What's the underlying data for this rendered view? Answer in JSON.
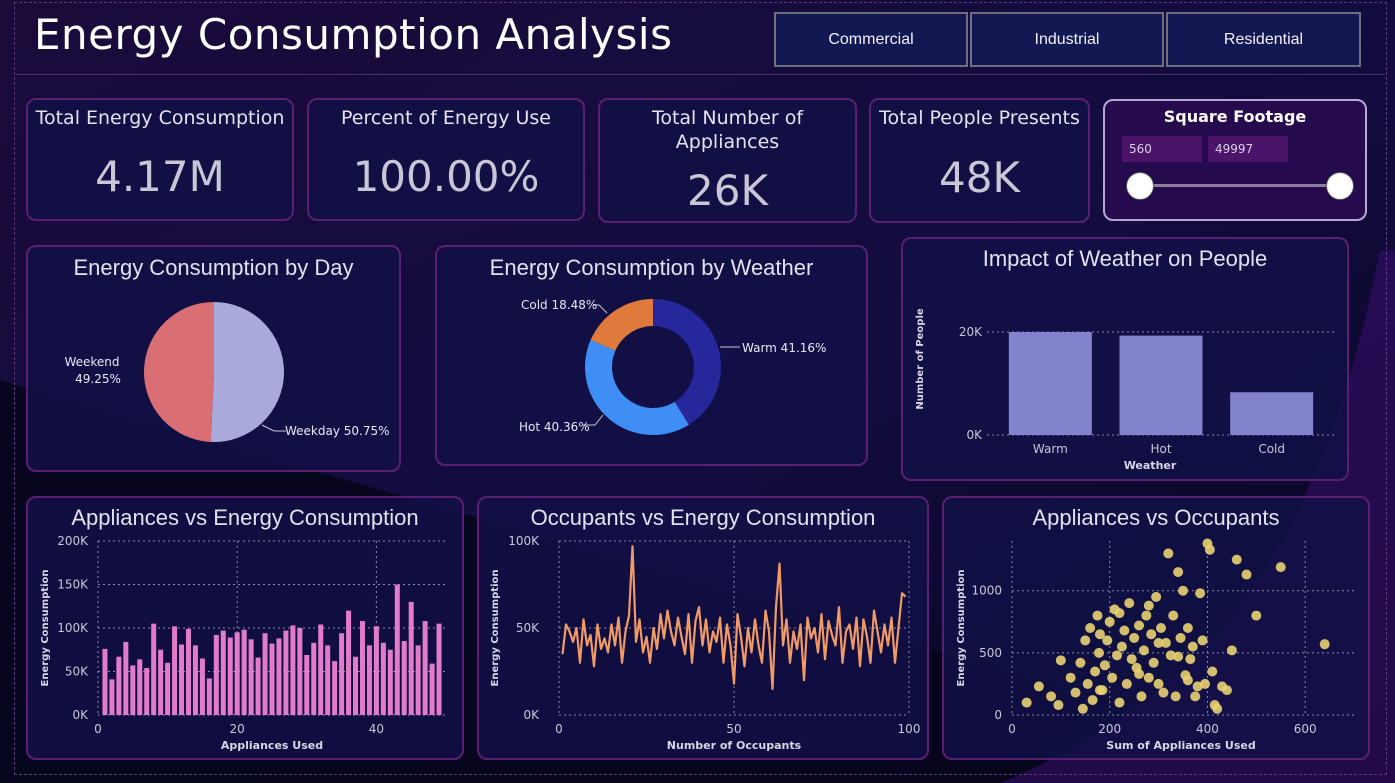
{
  "header": {
    "title": "Energy Consumption Analysis"
  },
  "segments": [
    "Commercial",
    "Industrial",
    "Residential"
  ],
  "kpis": [
    {
      "label": "Total Energy Consumption",
      "value": "4.17M"
    },
    {
      "label": "Percent of Energy Use",
      "value": "100.00%"
    },
    {
      "label": "Total Number of Appliances",
      "value": "26K"
    },
    {
      "label": "Total People Presents",
      "value": "48K"
    }
  ],
  "slider": {
    "label": "Square Footage",
    "min": "560",
    "max": "49997"
  },
  "chart_data": [
    {
      "type": "pie",
      "title": "Energy Consumption by Day",
      "categories": [
        "Weekday",
        "Weekend"
      ],
      "values": [
        50.75,
        49.25
      ],
      "labels": [
        "Weekday 50.75%",
        "Weekend",
        "49.25%"
      ],
      "colors": [
        "#aaa9db",
        "#d96f75"
      ]
    },
    {
      "type": "pie",
      "title": "Energy Consumption by Weather",
      "categories": [
        "Warm",
        "Hot",
        "Cold"
      ],
      "values": [
        41.16,
        40.36,
        18.48
      ],
      "labels": [
        "Warm 41.16%",
        "Hot 40.36%",
        "Cold 18.48%"
      ],
      "colors": [
        "#25279a",
        "#3f8ef5",
        "#e07a3c"
      ]
    },
    {
      "type": "bar",
      "title": "Impact of Weather on People",
      "categories": [
        "Warm",
        "Hot",
        "Cold"
      ],
      "values": [
        20000,
        19300,
        8300
      ],
      "xlabel": "Weather",
      "ylabel": "Number of People",
      "yticks": [
        "0K",
        "20K"
      ],
      "ylim": [
        0,
        20000
      ],
      "color": "#8283cc"
    },
    {
      "type": "bar",
      "title": "Appliances vs Energy Consumption",
      "xlabel": "Appliances Used",
      "ylabel": "Energy Consumption",
      "x": [
        1,
        2,
        3,
        4,
        5,
        6,
        7,
        8,
        9,
        10,
        11,
        12,
        13,
        14,
        15,
        16,
        17,
        18,
        19,
        20,
        21,
        22,
        23,
        24,
        25,
        26,
        27,
        28,
        29,
        30,
        31,
        32,
        33,
        34,
        35,
        36,
        37,
        38,
        39,
        40,
        41,
        42,
        43,
        44,
        45,
        46,
        47,
        48,
        49
      ],
      "values": [
        76000,
        41000,
        67000,
        84000,
        57000,
        64000,
        54000,
        105000,
        75000,
        60000,
        102000,
        81000,
        99000,
        80000,
        65000,
        42000,
        92000,
        97000,
        89000,
        95000,
        98000,
        87000,
        66000,
        94000,
        82000,
        88000,
        97000,
        103000,
        100000,
        69000,
        83000,
        104000,
        80000,
        62000,
        94000,
        120000,
        67000,
        108000,
        80000,
        102000,
        83000,
        75000,
        150000,
        85000,
        130000,
        80000,
        108000,
        59000,
        105000
      ],
      "ylim": [
        0,
        200000
      ],
      "yticks": [
        "0K",
        "50K",
        "100K",
        "150K",
        "200K"
      ],
      "xticks": [
        "0",
        "20",
        "40"
      ],
      "color": "#e27bc9"
    },
    {
      "type": "line",
      "title": "Occupants vs Energy Consumption",
      "xlabel": "Number of Occupants",
      "ylabel": "Energy Consumption",
      "values": [
        35000,
        52000,
        48000,
        42000,
        50000,
        30000,
        55000,
        40000,
        46000,
        28000,
        52000,
        38000,
        44000,
        36000,
        52000,
        40000,
        56000,
        30000,
        48000,
        57000,
        97000,
        42000,
        55000,
        36000,
        45000,
        30000,
        50000,
        38000,
        58000,
        44000,
        60000,
        48000,
        40000,
        56000,
        45000,
        35000,
        58000,
        30000,
        54000,
        62000,
        40000,
        55000,
        36000,
        48000,
        42000,
        56000,
        30000,
        52000,
        40000,
        18000,
        58000,
        45000,
        28000,
        50000,
        36000,
        55000,
        40000,
        30000,
        60000,
        48000,
        15000,
        62000,
        87000,
        40000,
        55000,
        30000,
        48000,
        38000,
        52000,
        20000,
        56000,
        44000,
        50000,
        36000,
        58000,
        32000,
        54000,
        46000,
        40000,
        62000,
        30000,
        48000,
        52000,
        38000,
        56000,
        28000,
        55000,
        45000,
        30000,
        60000,
        48000,
        36000,
        52000,
        40000,
        56000,
        30000,
        50000,
        70000,
        68000
      ],
      "xlim": [
        0,
        100
      ],
      "ylim": [
        0,
        100000
      ],
      "yticks": [
        "0K",
        "50K",
        "100K"
      ],
      "xticks": [
        "0",
        "50",
        "100"
      ],
      "color": "#f09a66"
    },
    {
      "type": "scatter",
      "title": "Appliances vs Occupants",
      "xlabel": "Sum of Appliances Used",
      "ylabel": "Energy Consumption",
      "xlim": [
        0,
        700
      ],
      "ylim": [
        0,
        1400
      ],
      "xticks": [
        "0",
        "200",
        "400",
        "600"
      ],
      "yticks": [
        "0",
        "500",
        "1000"
      ],
      "color": "#e8d271",
      "points": [
        [
          30,
          100
        ],
        [
          55,
          230
        ],
        [
          80,
          150
        ],
        [
          95,
          80
        ],
        [
          100,
          440
        ],
        [
          120,
          300
        ],
        [
          130,
          180
        ],
        [
          140,
          420
        ],
        [
          145,
          50
        ],
        [
          150,
          600
        ],
        [
          155,
          250
        ],
        [
          160,
          700
        ],
        [
          165,
          120
        ],
        [
          170,
          350
        ],
        [
          175,
          800
        ],
        [
          178,
          500
        ],
        [
          180,
          650
        ],
        [
          185,
          200
        ],
        [
          190,
          400
        ],
        [
          195,
          600
        ],
        [
          200,
          750
        ],
        [
          205,
          300
        ],
        [
          210,
          850
        ],
        [
          215,
          480
        ],
        [
          220,
          100
        ],
        [
          225,
          550
        ],
        [
          230,
          680
        ],
        [
          235,
          250
        ],
        [
          240,
          900
        ],
        [
          245,
          450
        ],
        [
          250,
          620
        ],
        [
          255,
          380
        ],
        [
          260,
          720
        ],
        [
          265,
          150
        ],
        [
          270,
          520
        ],
        [
          275,
          800
        ],
        [
          280,
          300
        ],
        [
          285,
          650
        ],
        [
          290,
          420
        ],
        [
          295,
          950
        ],
        [
          300,
          250
        ],
        [
          305,
          700
        ],
        [
          310,
          180
        ],
        [
          315,
          580
        ],
        [
          320,
          1300
        ],
        [
          325,
          480
        ],
        [
          330,
          800
        ],
        [
          335,
          150
        ],
        [
          340,
          1150
        ],
        [
          345,
          620
        ],
        [
          350,
          1000
        ],
        [
          355,
          320
        ],
        [
          360,
          700
        ],
        [
          365,
          450
        ],
        [
          370,
          550
        ],
        [
          375,
          150
        ],
        [
          380,
          230
        ],
        [
          385,
          980
        ],
        [
          390,
          600
        ],
        [
          395,
          250
        ],
        [
          400,
          1380
        ],
        [
          405,
          1330
        ],
        [
          410,
          350
        ],
        [
          415,
          80
        ],
        [
          420,
          50
        ],
        [
          430,
          230
        ],
        [
          440,
          200
        ],
        [
          450,
          520
        ],
        [
          460,
          1250
        ],
        [
          480,
          1130
        ],
        [
          500,
          800
        ],
        [
          550,
          1190
        ],
        [
          640,
          570
        ],
        [
          180,
          200
        ],
        [
          220,
          820
        ],
        [
          260,
          330
        ],
        [
          300,
          580
        ],
        [
          340,
          470
        ],
        [
          360,
          280
        ],
        [
          280,
          880
        ]
      ]
    }
  ]
}
